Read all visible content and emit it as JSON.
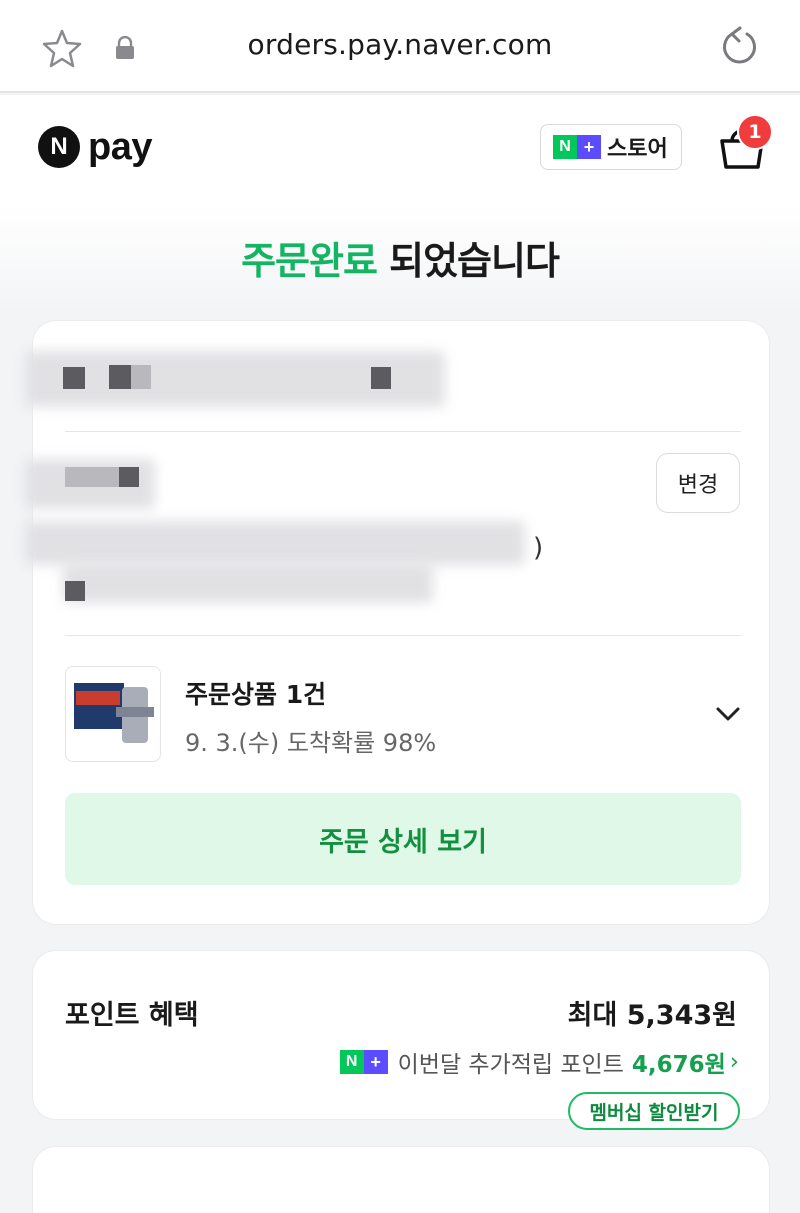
{
  "browser": {
    "url": "orders.pay.naver.com"
  },
  "header": {
    "logo_mark": "N",
    "logo_text": "pay",
    "store_label": "스토어",
    "cart_count": "1"
  },
  "hero": {
    "title_accent": "주문완료",
    "title_rest": " 되었습니다"
  },
  "order": {
    "change_label": "변경",
    "address_paren": ")",
    "product_title": "주문상품 1건",
    "product_delivery": "9. 3.(수) 도착확률 98%",
    "detail_button": "주문 상세 보기"
  },
  "points": {
    "title": "포인트 혜택",
    "max_label": "최대 5,343원",
    "extra_label": "이번달 추가적립 포인트",
    "extra_amount": "4,676원",
    "membership_button": "멤버십 할인받기"
  },
  "colors": {
    "accent_green": "#14b562",
    "badge_red": "#f03c3c",
    "nplus_green": "#03c75a",
    "nplus_purple": "#5b4dff"
  }
}
